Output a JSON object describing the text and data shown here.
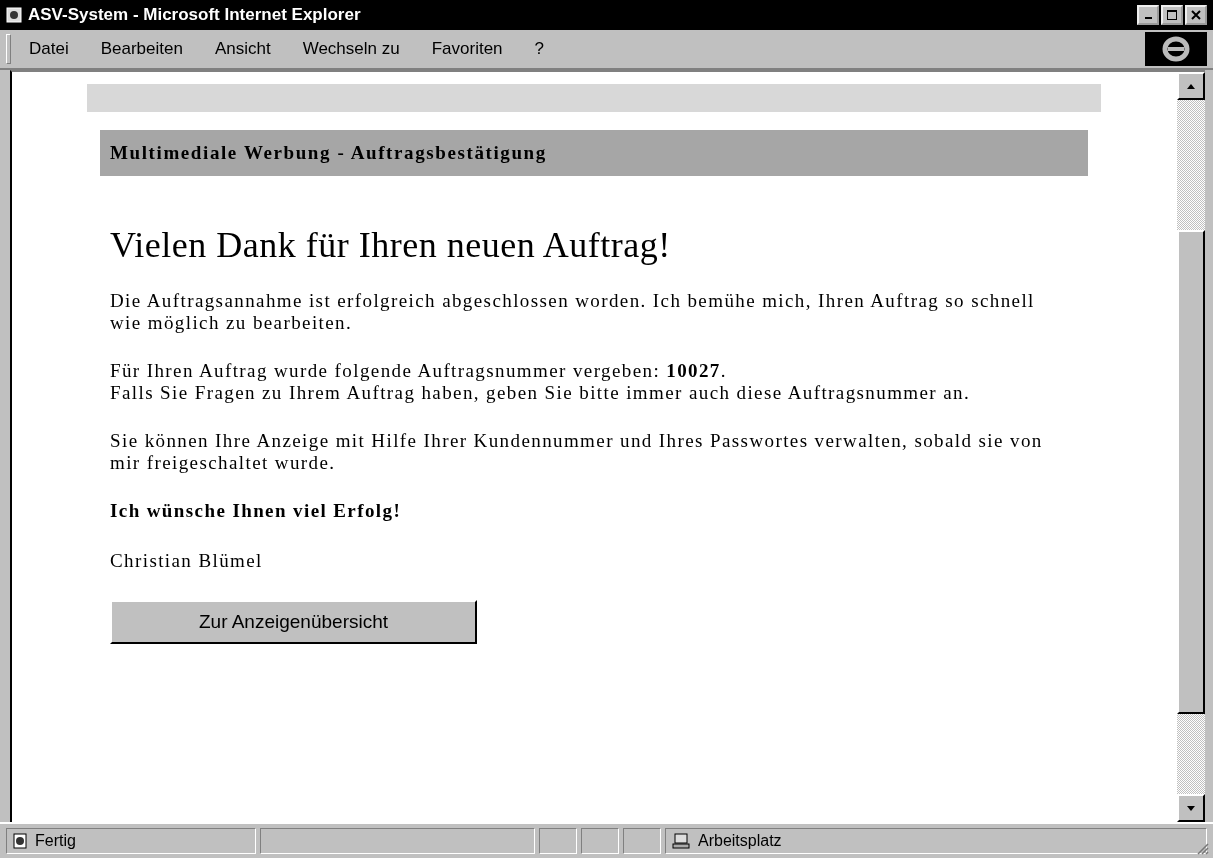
{
  "window": {
    "title": "ASV-System - Microsoft Internet Explorer"
  },
  "menu": [
    "Datei",
    "Bearbeiten",
    "Ansicht",
    "Wechseln zu",
    "Favoriten",
    "?"
  ],
  "page": {
    "header": "Multimediale Werbung - Auftragsbestätigung",
    "heading": "Vielen Dank für Ihren neuen Auftrag!",
    "paragraphs": [
      [
        "Die Auftragsannahme ist erfolgreich abgeschlossen worden. Ich bemühe mich, Ihren Auftrag so schnell wie möglich zu bearbeiten."
      ],
      [
        "Für Ihren Auftrag wurde folgende Auftragsnummer vergeben: **10027**.",
        "Falls Sie Fragen zu Ihrem Auftrag haben, geben Sie bitte immer auch diese Auftragsnummer an."
      ],
      [
        "Sie können Ihre Anzeige mit Hilfe Ihrer Kundennummer und Ihres Passwortes verwalten, sobald sie von mir freigeschaltet wurde."
      ]
    ],
    "closing": "Ich wünsche Ihnen viel Erfolg!",
    "signature": "Christian Blümel",
    "button": "Zur Anzeigenübersicht"
  },
  "status_bar": {
    "status": "Fertig",
    "zone": "Arbeitsplatz"
  }
}
